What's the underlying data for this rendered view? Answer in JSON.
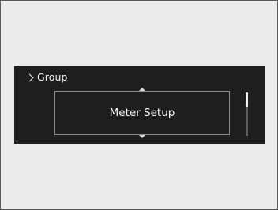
{
  "header": {
    "group_label": "Group",
    "back_icon": "chevron-right-icon"
  },
  "menu": {
    "selected_item": "Meter Setup",
    "scroll_up_icon": "arrow-up-icon",
    "scroll_down_icon": "arrow-down-icon"
  },
  "scrollbar": {
    "position_fraction": 0.0,
    "thumb_fraction": 0.35
  },
  "colors": {
    "screen_background": "#1e1e1e",
    "text": "#f2f2f2",
    "outline": "#8c8c8c",
    "page_background": "#ebebeb"
  }
}
